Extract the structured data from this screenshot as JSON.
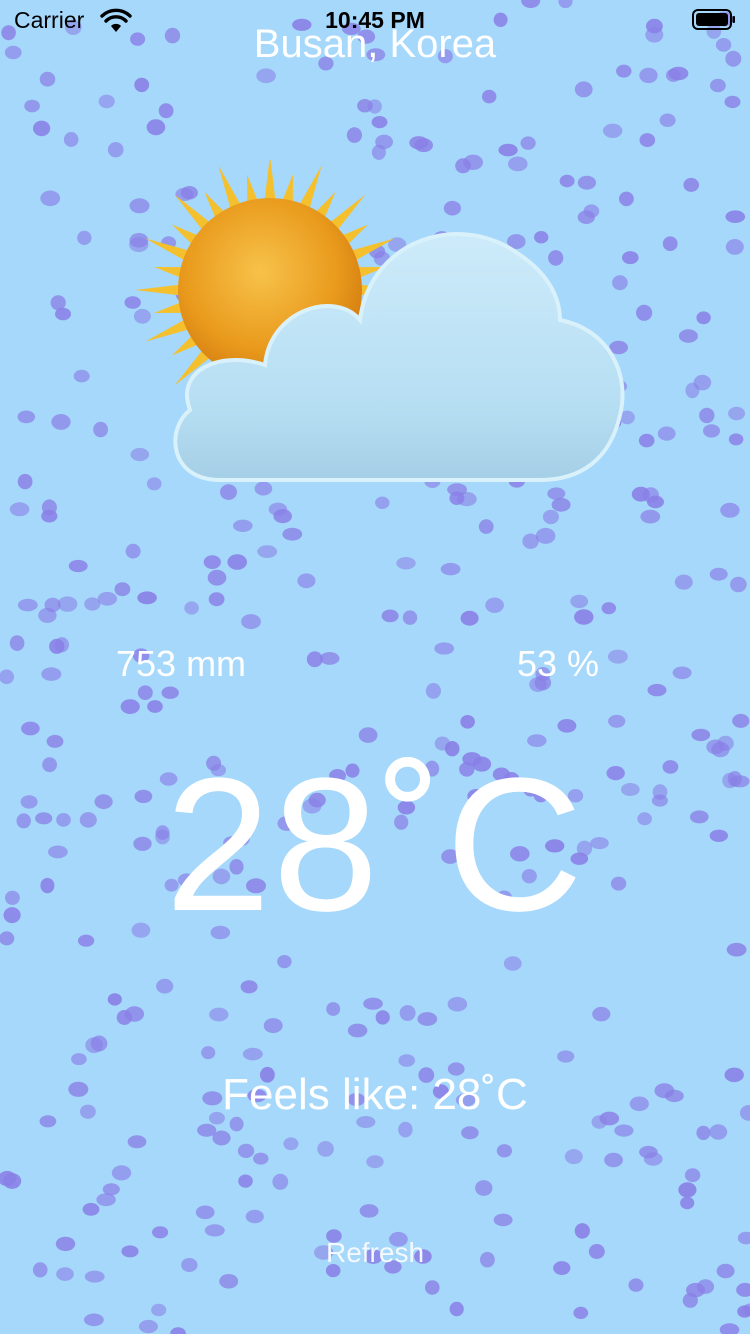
{
  "status_bar": {
    "carrier": "Carrier",
    "time": "10:45 PM"
  },
  "location": {
    "city": "Busan, Korea"
  },
  "weather": {
    "icon": "partly-cloudy-icon",
    "pressure": "753 mm",
    "humidity": "53 %",
    "temperature": "28˚C",
    "feels_like": "Feels like: 28˚C"
  },
  "actions": {
    "refresh_label": "Refresh"
  },
  "colors": {
    "background": "#a5d8fb",
    "rain_drop": "#8a7fe6",
    "text": "#ffffff"
  }
}
